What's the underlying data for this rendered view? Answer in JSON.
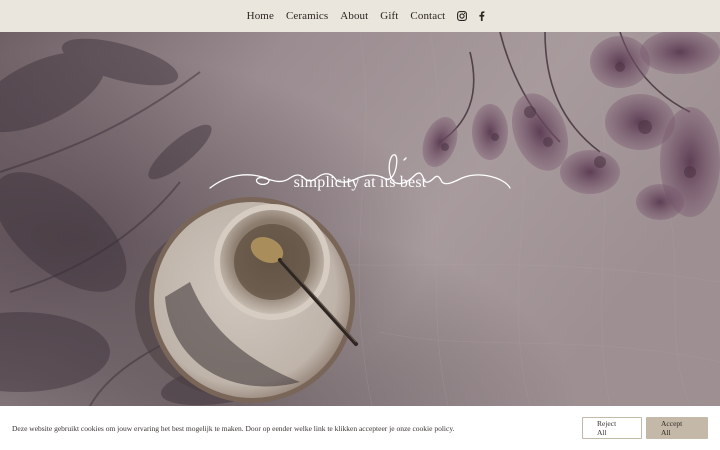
{
  "header": {
    "nav": [
      {
        "label": "Home"
      },
      {
        "label": "Ceramics"
      },
      {
        "label": "About"
      },
      {
        "label": "Gift"
      },
      {
        "label": "Contact"
      }
    ],
    "social": [
      {
        "icon": "instagram-icon"
      },
      {
        "icon": "facebook-icon"
      }
    ]
  },
  "hero": {
    "tagline": "simplicity at its best"
  },
  "cookie_banner": {
    "text": "Deze website gebruikt cookies om jouw ervaring het best mogelijk te maken. Door op eender welke link te klikken accepteer je onze cookie policy.",
    "reject_label": "Reject All",
    "accept_label": "Accept All"
  },
  "colors": {
    "header_bg": "#ebe6dd",
    "accept_button": "#c4b8a8",
    "text_dark": "#2b2320"
  }
}
